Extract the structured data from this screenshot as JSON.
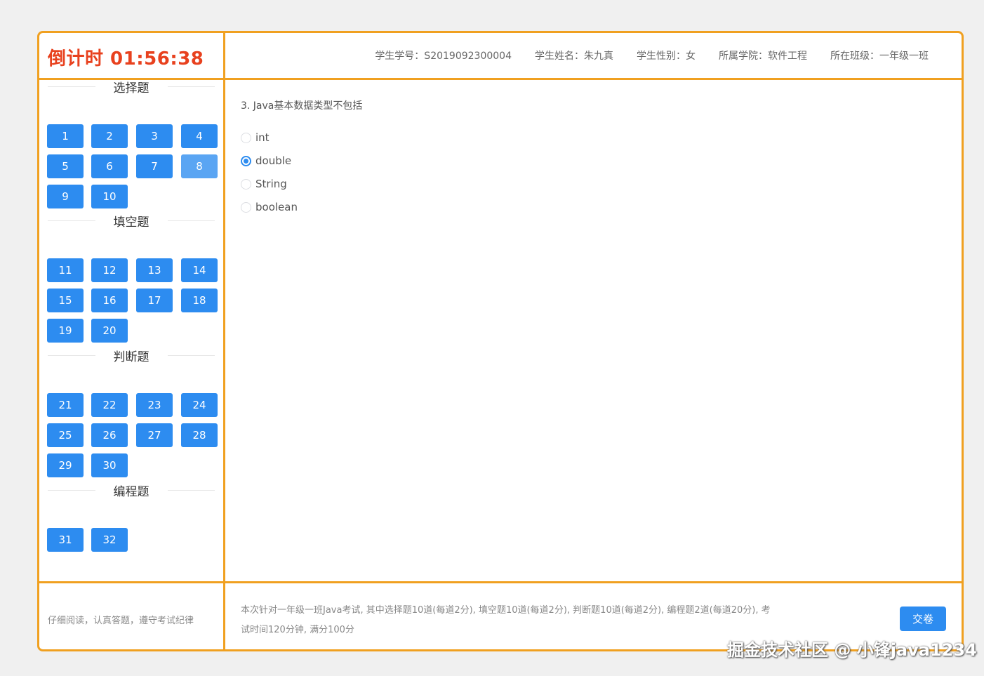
{
  "header": {
    "timer": "倒计时 01:56:38",
    "info": [
      "学生学号：S2019092300004",
      "学生姓名：朱九真",
      "学生性别：女",
      "所属学院：软件工程",
      "所在班级：一年级一班"
    ]
  },
  "sidebar": {
    "sections": [
      {
        "title": "选择题",
        "questions": [
          "1",
          "2",
          "3",
          "4",
          "5",
          "6",
          "7",
          "8",
          "9",
          "10"
        ]
      },
      {
        "title": "填空题",
        "questions": [
          "11",
          "12",
          "13",
          "14",
          "15",
          "16",
          "17",
          "18",
          "19",
          "20"
        ]
      },
      {
        "title": "判断题",
        "questions": [
          "21",
          "22",
          "23",
          "24",
          "25",
          "26",
          "27",
          "28",
          "29",
          "30"
        ]
      },
      {
        "title": "编程题",
        "questions": [
          "31",
          "32"
        ]
      }
    ],
    "current_question": "8"
  },
  "main": {
    "question_text": "3. Java基本数据类型不包括",
    "options": [
      "int",
      "double",
      "String",
      "boolean"
    ],
    "selected_option": "double"
  },
  "footer": {
    "notice": "仔细阅读，认真答题，遵守考试纪律",
    "description_line1": "本次针对一年级一班Java考试, 其中选择题10道(每道2分), 填空题10道(每道2分), 判断题10道(每道2分), 编程题2道(每道20分), 考",
    "description_line2": "试时间120分钟, 满分100分",
    "submit_label": "交卷"
  },
  "watermark": "掘金技术社区 @ 小锋java1234",
  "colors": {
    "border": "#f0a020",
    "button": "#2d8cf0",
    "timer": "#e8411e"
  }
}
